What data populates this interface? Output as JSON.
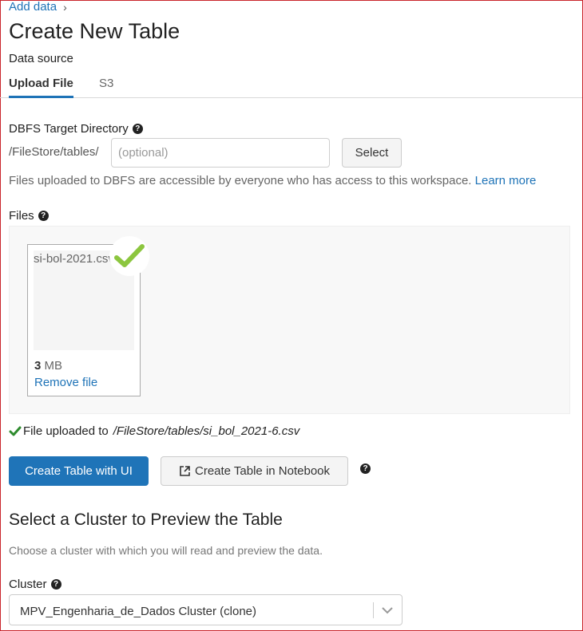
{
  "breadcrumb": {
    "label": "Add data",
    "separator": "›"
  },
  "page": {
    "title": "Create New Table"
  },
  "data_source": {
    "label": "Data source",
    "tabs": [
      {
        "label": "Upload File",
        "active": true
      },
      {
        "label": "S3",
        "active": false
      }
    ]
  },
  "dbfs": {
    "label": "DBFS Target Directory",
    "help_icon": "question-circle-icon",
    "path_prefix": "/FileStore/tables/",
    "input_placeholder": "(optional)",
    "input_value": "",
    "select_label": "Select",
    "note": "Files uploaded to DBFS are accessible by everyone who has access to this workspace.",
    "learn_more": "Learn more"
  },
  "files": {
    "label": "Files",
    "help_icon": "question-circle-icon",
    "items": [
      {
        "name": "si-bol-2021.csv",
        "size_value": "3",
        "size_unit": "MB",
        "remove_label": "Remove file",
        "status_icon": "checkmark-icon"
      }
    ]
  },
  "upload_status": {
    "prefix": "File uploaded to",
    "path": "/FileStore/tables/si_bol_2021-6.csv",
    "icon": "checkmark-icon"
  },
  "actions": {
    "create_ui": "Create Table with UI",
    "create_notebook": "Create Table in Notebook",
    "notebook_icon": "external-link-icon",
    "help_icon": "question-circle-icon"
  },
  "cluster": {
    "title": "Select a Cluster to Preview the Table",
    "description": "Choose a cluster with which you will read and preview the data.",
    "label": "Cluster",
    "selected": "MPV_Engenharia_de_Dados Cluster (clone)"
  },
  "colors": {
    "accent": "#1e73b7",
    "primary_button": "#1f74b8",
    "success": "#2e8b2e",
    "check_badge": "#8cc63f"
  }
}
